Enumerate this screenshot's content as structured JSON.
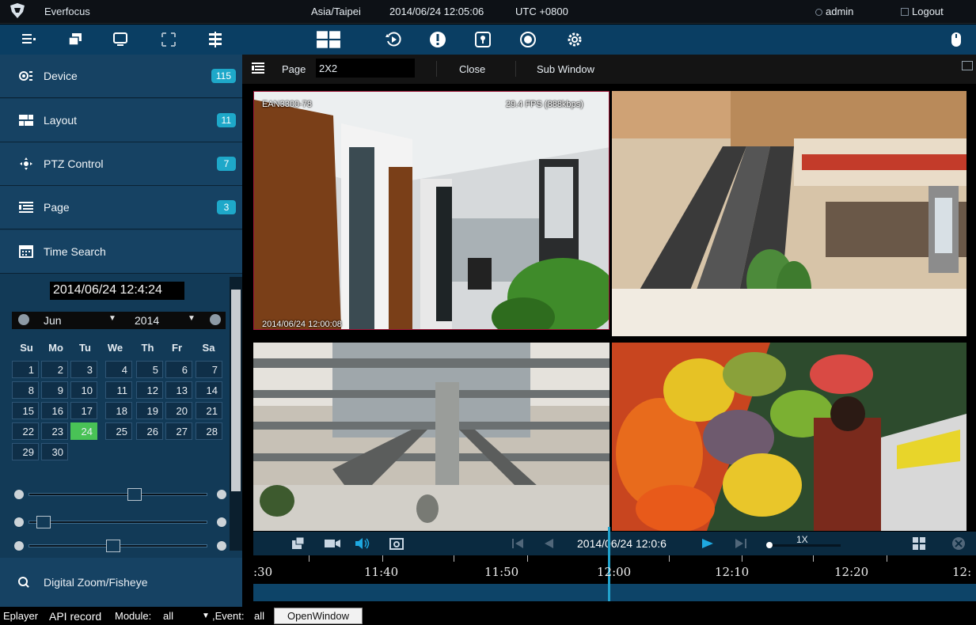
{
  "topbar": {
    "app_name": "Everfocus",
    "timezone": "Asia/Taipei",
    "datetime": "2014/06/24 12:05:06",
    "utc": "UTC +0800",
    "user": "admin",
    "logout": "Logout"
  },
  "toolbar": {
    "left_icons": [
      "list-icon",
      "windows-icon",
      "monitor-icon",
      "fullscreen-icon",
      "grid-split-icon"
    ],
    "center_icons": [
      "layout-icon",
      "playback-icon",
      "alert-icon",
      "lock-icon",
      "settings-alt-icon",
      "gear-icon"
    ],
    "right_icon": "mouse-icon"
  },
  "sidebar": {
    "items": [
      {
        "label": "Device",
        "badge": "115",
        "icon": "device-icon"
      },
      {
        "label": "Layout",
        "badge": "11",
        "icon": "layout-icon"
      },
      {
        "label": "PTZ Control",
        "badge": "7",
        "icon": "ptz-icon"
      },
      {
        "label": "Page",
        "badge": "3",
        "icon": "page-icon"
      },
      {
        "label": "Time Search",
        "icon": "calendar-icon"
      }
    ],
    "time_search": {
      "value": "2014/06/24 12:4:24",
      "month": "Jun",
      "year": "2014",
      "weekdays": [
        "Su",
        "Mo",
        "Tu",
        "We",
        "Th",
        "Fr",
        "Sa"
      ],
      "days": [
        "1",
        "2",
        "3",
        "4",
        "5",
        "6",
        "7",
        "8",
        "9",
        "10",
        "11",
        "12",
        "13",
        "14",
        "15",
        "16",
        "17",
        "18",
        "19",
        "20",
        "21",
        "22",
        "23",
        "24",
        "25",
        "26",
        "27",
        "28",
        "29",
        "30"
      ],
      "selected_day": "24"
    },
    "sliders": [
      {
        "name": "slider-1",
        "value": 0.6
      },
      {
        "name": "slider-2",
        "value": 0.05
      },
      {
        "name": "slider-3",
        "value": 0.47
      }
    ],
    "digital_zoom": "Digital Zoom/Fisheye"
  },
  "pagebar": {
    "label": "Page",
    "value": "2X2",
    "close": "Close",
    "sub_window": "Sub Window"
  },
  "tiles": [
    {
      "camera": "EAN3300-78",
      "fps": "29.4 FPS (888kbps)",
      "timestamp": "2014/06/24 12:00:08"
    },
    {
      "camera": "",
      "fps": "",
      "timestamp": ""
    },
    {
      "camera": "",
      "fps": "",
      "timestamp": ""
    },
    {
      "camera": "",
      "fps": "",
      "timestamp": ""
    }
  ],
  "playback": {
    "datetime": "2014/06/24 12:0:6",
    "speed": "1X"
  },
  "timeline": {
    "labels": [
      ":30",
      "11:40",
      "11:50",
      "12:00",
      "12:10",
      "12:20",
      "12:"
    ]
  },
  "statusbar": {
    "eplayer": "Eplayer",
    "api": "API record",
    "module_label": "Module:",
    "module_value": "all",
    "event_label": ",Event:",
    "event_value": "all",
    "open_window": "OpenWindow"
  },
  "colors": {
    "toolbar_bg": "#0a3e63",
    "sidebar_bg": "#164263",
    "badge": "#1ea8c9",
    "selected_day": "#49c256"
  }
}
